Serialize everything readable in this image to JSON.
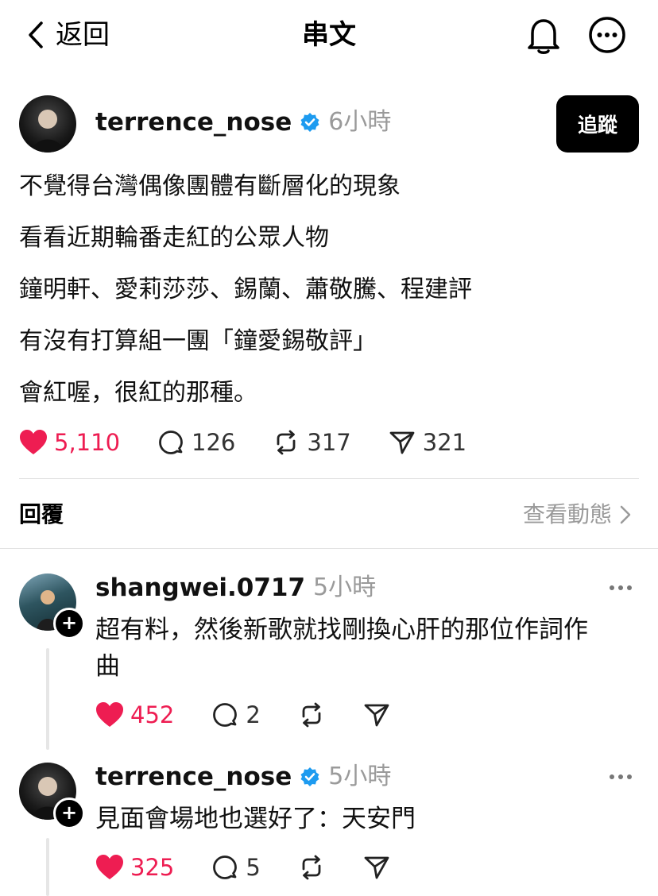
{
  "header": {
    "back_label": "返回",
    "title": "串文"
  },
  "post": {
    "username": "terrence_nose",
    "time": "6小時",
    "follow_label": "追蹤",
    "lines": [
      "不覺得台灣偶像團體有斷層化的現象",
      "看看近期輪番走紅的公眾人物",
      "鐘明軒、愛莉莎莎、錫蘭、蕭敬騰、程建評",
      "有沒有打算組一團「鐘愛錫敬評」",
      "會紅喔，很紅的那種。"
    ],
    "likes": "5,110",
    "comments": "126",
    "reposts": "317",
    "shares": "321"
  },
  "replies_section": {
    "label": "回覆",
    "activity_label": "查看動態"
  },
  "replies": [
    {
      "username": "shangwei.0717",
      "time": "5小時",
      "text_line1": "超有料，然後新歌就找剛換心肝的那位作詞作",
      "text_line2": "曲",
      "likes": "452",
      "comments": "2"
    },
    {
      "username": "terrence_nose",
      "time": "5小時",
      "text_line1": "見面會場地也選好了：天安門",
      "likes": "325",
      "comments": "5"
    }
  ],
  "colors": {
    "like_red": "#ee1d52",
    "verified_blue": "#1d9bf0",
    "muted_gray": "#9a9a9a"
  }
}
